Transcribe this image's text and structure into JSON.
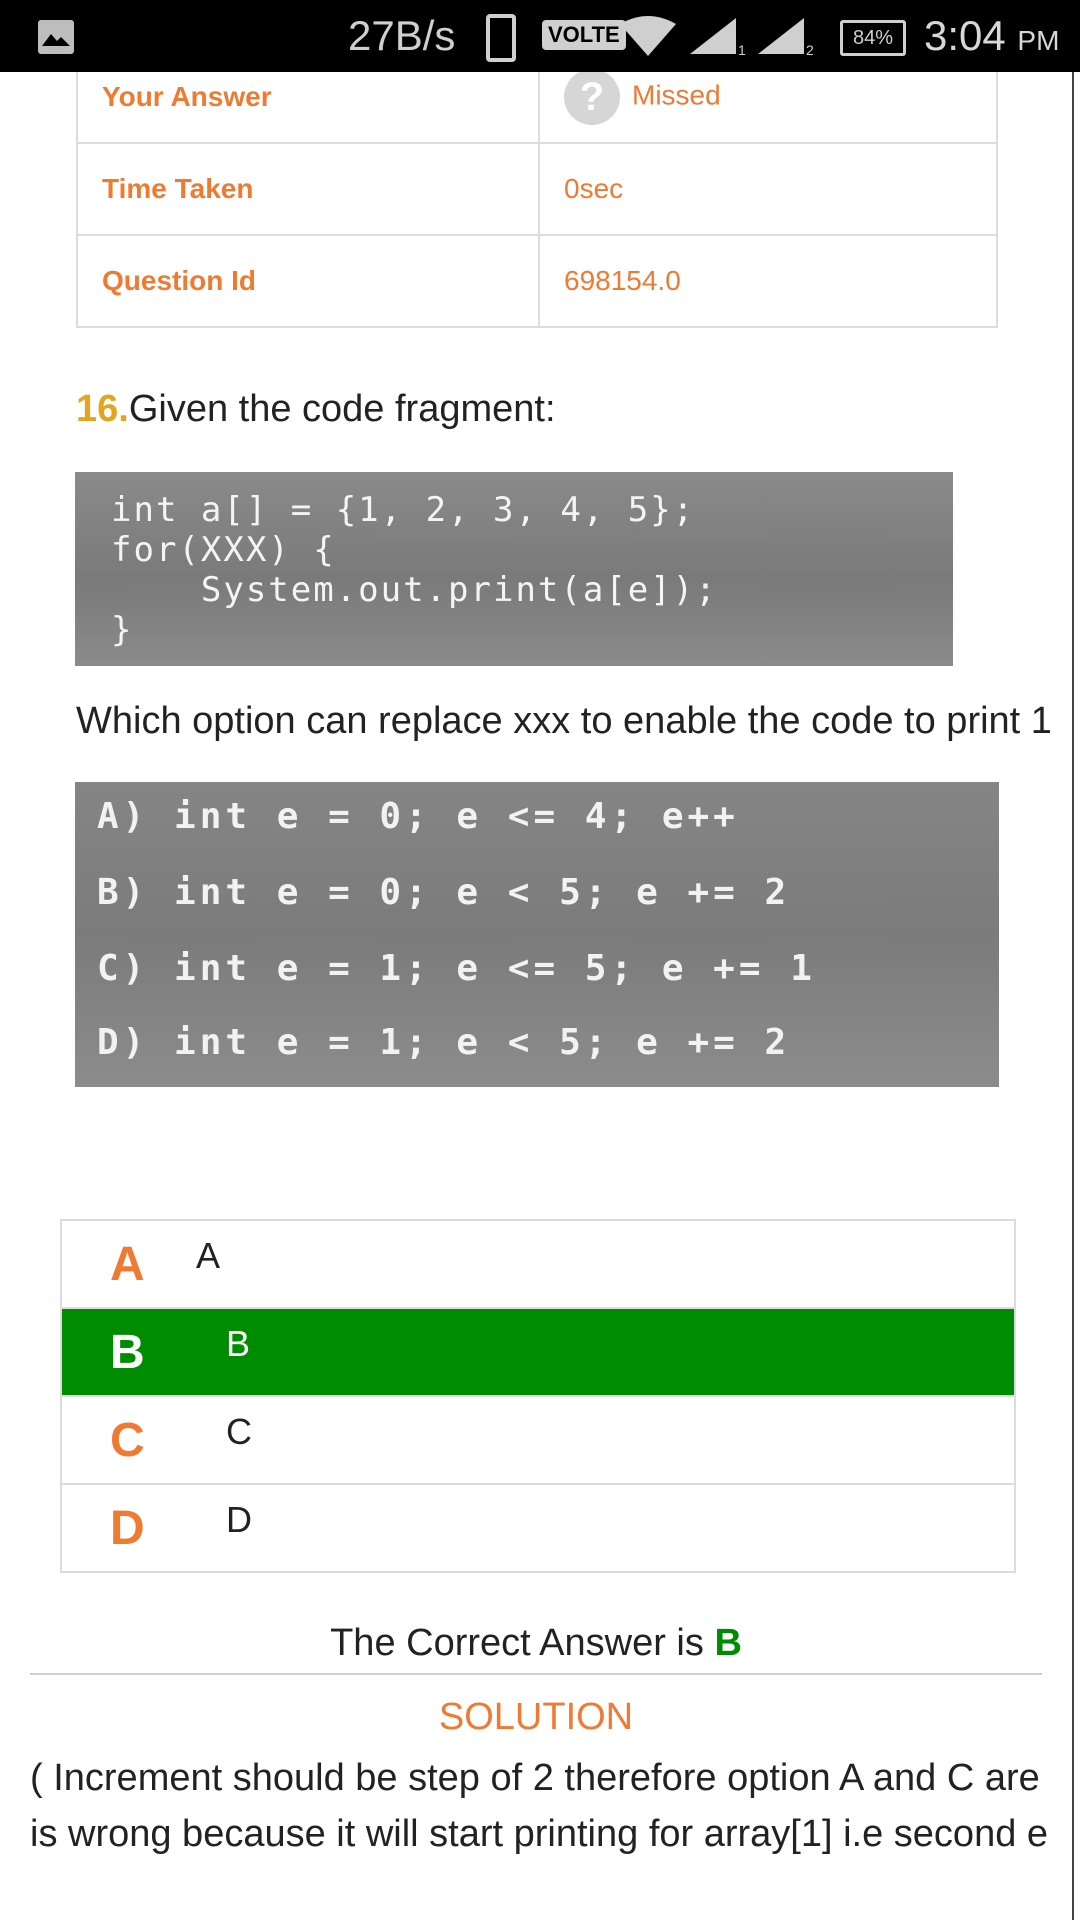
{
  "status_bar": {
    "speed": "27B/s",
    "volte": "VOLTE",
    "sim1": "1",
    "sim2": "2",
    "battery": "84%",
    "time": "3:04",
    "ampm": "PM"
  },
  "info_table": {
    "rows": [
      {
        "key": "Your Answer",
        "value": "Missed"
      },
      {
        "key": "Time Taken",
        "value": "0sec"
      },
      {
        "key": "Question Id",
        "value": "698154.0"
      }
    ]
  },
  "question": {
    "number": "16.",
    "title": "Given the code fragment:",
    "code": "int a[] = {1, 2, 3, 4, 5};\nfor(XXX) {\n    System.out.print(a[e]);\n}",
    "prompt": "Which option can replace xxx to enable the code to print 1",
    "option_lines": [
      "A) int e = 0; e <= 4; e++",
      "B) int e = 0; e < 5; e += 2",
      "C) int e = 1; e <= 5; e += 1",
      "D) int e = 1; e < 5; e += 2"
    ]
  },
  "choices": [
    {
      "letter": "A",
      "text": "A",
      "selected": false
    },
    {
      "letter": "B",
      "text": "B",
      "selected": true
    },
    {
      "letter": "C",
      "text": "C",
      "selected": false
    },
    {
      "letter": "D",
      "text": "D",
      "selected": false
    }
  ],
  "result": {
    "correct_prefix": "The Correct Answer is ",
    "correct_letter": "B"
  },
  "solution": {
    "title": "SOLUTION",
    "line1": "( Increment should be step of 2 therefore option A and C are",
    "line2": "is wrong because  it will start printing for array[1] i.e second e"
  },
  "colors": {
    "accent_orange": "#f07a32",
    "number_gold": "#e6a41e",
    "correct_green": "#008c00"
  }
}
